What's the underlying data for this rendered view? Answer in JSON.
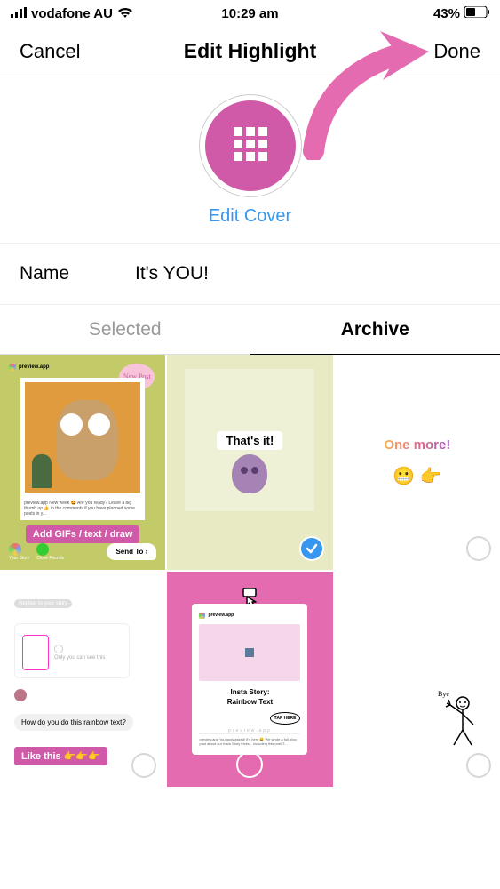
{
  "statusbar": {
    "carrier": "vodafone AU",
    "time": "10:29 am",
    "battery": "43%"
  },
  "navbar": {
    "cancel": "Cancel",
    "title": "Edit Highlight",
    "done": "Done"
  },
  "cover": {
    "edit_cover": "Edit Cover"
  },
  "name": {
    "label": "Name",
    "value": "It's YOU!"
  },
  "tabs": {
    "selected": "Selected",
    "archive": "Archive"
  },
  "tiles": {
    "t1": {
      "new_post": "New Post",
      "account": "preview.app",
      "caption": "preview.app New week 🤩 Are you ready? Leave a big thumb up 👍 in the comments if you have planned some posts in y...",
      "pill": "Add GIFs / text / draw",
      "send_to": "Send To",
      "your_story": "Your Story",
      "close_friends": "Close Friends"
    },
    "t2": {
      "label": "That's it!"
    },
    "t3": {
      "label": "One more!",
      "emoji": "😬 👉"
    },
    "t4": {
      "replied": "Replied to your story",
      "only_you": "Only you can see this",
      "question": "How do you do this rainbow text?",
      "like_this": "Like this 👉👉👉"
    },
    "t5": {
      "account": "preview.app",
      "title_l1": "Insta Story:",
      "title_l2": "Rainbow Text",
      "tap_here": "TAP HERE",
      "footer": "preview.app",
      "caption": "preview.app You guys asked! It's here 😄 We wrote a full blog post about our Insta Story tricks... including this one! T..."
    },
    "t6": {
      "bye": "Bye"
    }
  }
}
